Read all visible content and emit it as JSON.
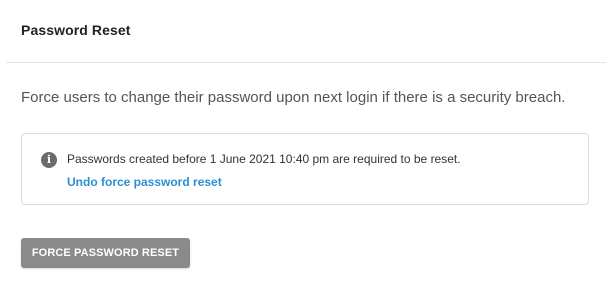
{
  "card": {
    "title": "Password Reset",
    "description": "Force users to change their password upon next login if there is a security breach."
  },
  "notice": {
    "icon": "info-icon",
    "icon_glyph": "i",
    "message": "Passwords created before 1 June 2021 10:40 pm are required to be reset.",
    "undo_link": "Undo force password reset"
  },
  "actions": {
    "force_reset_label": "FORCE PASSWORD RESET"
  },
  "colors": {
    "link": "#2a8fd0",
    "button_bg": "#8a8a8a",
    "icon_bg": "#6b6b6b"
  }
}
